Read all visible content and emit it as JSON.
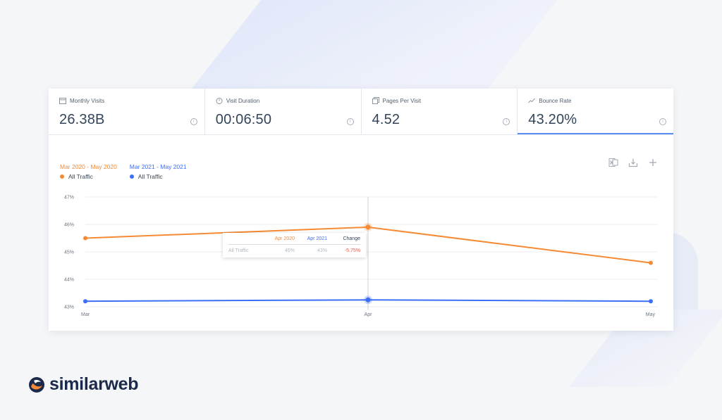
{
  "metrics": [
    {
      "label": "Monthly Visits",
      "value": "26.38B",
      "icon": "calendar-icon"
    },
    {
      "label": "Visit Duration",
      "value": "00:06:50",
      "icon": "stopwatch-icon"
    },
    {
      "label": "Pages Per Visit",
      "value": "4.52",
      "icon": "pages-icon"
    },
    {
      "label": "Bounce Rate",
      "value": "43.20%",
      "icon": "trend-icon",
      "active": true
    }
  ],
  "info_glyph": "i",
  "legend": [
    {
      "period": "Mar 2020 - May 2020",
      "series": "All Traffic",
      "color": "#f58a34"
    },
    {
      "period": "Mar 2021 - May 2021",
      "series": "All Traffic",
      "color": "#3d6ef7"
    }
  ],
  "toolbar": {
    "icons": [
      "excel-icon",
      "download-icon",
      "plus-icon"
    ]
  },
  "tooltip": {
    "headers": [
      "",
      "Apr 2020",
      "Apr 2021",
      "Change"
    ],
    "row": [
      "All Traffic",
      "46%",
      "43%",
      "-5.75%"
    ],
    "change_color": "#f0554a"
  },
  "chart_data": {
    "type": "line",
    "categories": [
      "Mar",
      "Apr",
      "May"
    ],
    "series": [
      {
        "name": "All Traffic",
        "period": "Mar 2020 - May 2020",
        "color": "#f58a34",
        "values": [
          45.5,
          45.9,
          44.6
        ]
      },
      {
        "name": "All Traffic",
        "period": "Mar 2021 - May 2021",
        "color": "#3d6ef7",
        "values": [
          43.2,
          43.25,
          43.2
        ]
      }
    ],
    "y_ticks": [
      "47%",
      "46%",
      "45%",
      "44%",
      "43%"
    ],
    "ylim": [
      43,
      47
    ],
    "grid": true,
    "highlight_category": "Apr"
  },
  "brand": {
    "name": "similarweb",
    "color": "#1b2a4a",
    "accent": "#f58a34"
  }
}
